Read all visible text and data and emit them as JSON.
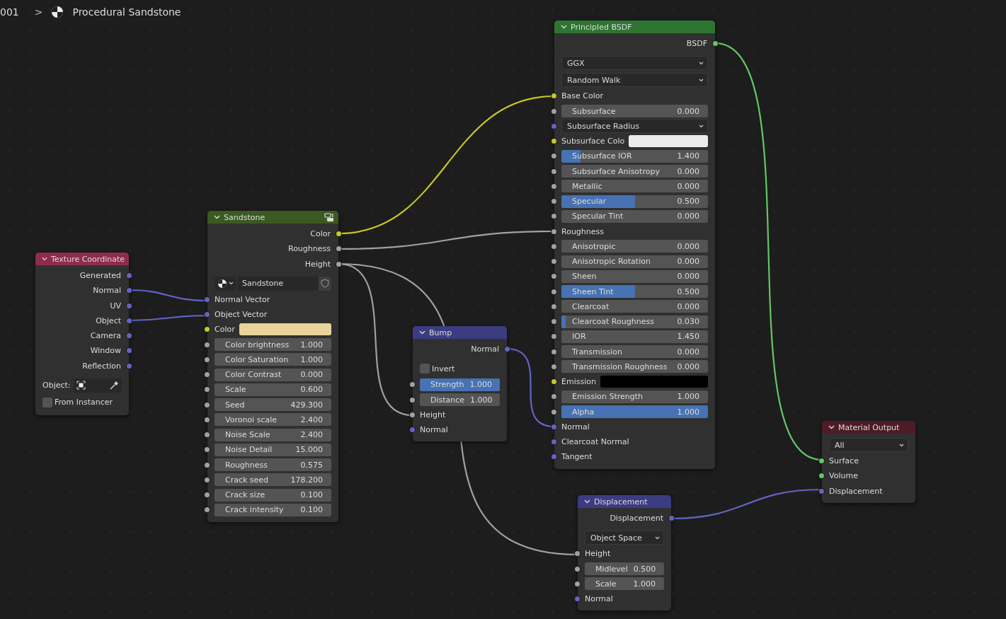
{
  "breadcrumb": {
    "prefix": "001",
    "separator": ">",
    "title": "Procedural Sandstone"
  },
  "nodes": [
    {
      "title": "Texture Coordinate",
      "kind": "shader",
      "color": "#8e2c4c",
      "rows": [
        {
          "kind": "output",
          "label": "Generated",
          "socket": {
            "color": "#6363c7"
          }
        },
        {
          "kind": "output",
          "label": "Normal",
          "socket": {
            "color": "#6363c7"
          }
        },
        {
          "kind": "output",
          "label": "UV",
          "socket": {
            "color": "#6363c7"
          }
        },
        {
          "kind": "output",
          "label": "Object",
          "socket": {
            "color": "#6363c7"
          }
        },
        {
          "kind": "output",
          "label": "Camera",
          "socket": {
            "color": "#6363c7"
          }
        },
        {
          "kind": "output",
          "label": "Window",
          "socket": {
            "color": "#6363c7"
          }
        },
        {
          "kind": "output",
          "label": "Reflection",
          "socket": {
            "color": "#6363c7"
          }
        },
        {
          "kind": "object",
          "label": "Object:"
        },
        {
          "kind": "checkbox",
          "label": "From Instancer",
          "checked": false
        }
      ]
    },
    {
      "title": "Sandstone",
      "kind": "group",
      "color": "#3b5a22",
      "rows": [
        {
          "kind": "output",
          "label": "Color",
          "socket": {
            "color": "#c7c729"
          }
        },
        {
          "kind": "output",
          "label": "Roughness",
          "socket": {
            "color": "#a1a1a1"
          }
        },
        {
          "kind": "output",
          "label": "Height",
          "socket": {
            "color": "#a1a1a1"
          }
        },
        {
          "kind": "datablock",
          "value": "Sandstone"
        },
        {
          "kind": "input",
          "label": "Normal Vector",
          "socket": {
            "color": "#6363c7"
          }
        },
        {
          "kind": "input",
          "label": "Object Vector",
          "socket": {
            "color": "#6363c7"
          }
        },
        {
          "kind": "color",
          "label": "Color",
          "socket": {
            "color": "#c7c729"
          },
          "swatch": {
            "color": "#e8d49a"
          }
        },
        {
          "kind": "slider",
          "label": "Color brightness",
          "value": "1.000",
          "level": 0,
          "socket": {
            "color": "#a1a1a1"
          }
        },
        {
          "kind": "slider",
          "label": "Color Saturation",
          "value": "1.000",
          "level": 0,
          "socket": {
            "color": "#a1a1a1"
          }
        },
        {
          "kind": "slider",
          "label": "Color Contrast",
          "value": "0.000",
          "level": 0,
          "socket": {
            "color": "#a1a1a1"
          }
        },
        {
          "kind": "slider",
          "label": "Scale",
          "value": "0.600",
          "level": 0,
          "socket": {
            "color": "#a1a1a1"
          }
        },
        {
          "kind": "slider",
          "label": "Seed",
          "value": "429.300",
          "level": 0,
          "socket": {
            "color": "#a1a1a1"
          }
        },
        {
          "kind": "slider",
          "label": "Voronoi scale",
          "value": "2.400",
          "level": 0,
          "socket": {
            "color": "#a1a1a1"
          }
        },
        {
          "kind": "slider",
          "label": "Noise Scale",
          "value": "2.400",
          "level": 0,
          "socket": {
            "color": "#a1a1a1"
          }
        },
        {
          "kind": "slider",
          "label": "Noise Detail",
          "value": "15.000",
          "level": 0,
          "socket": {
            "color": "#a1a1a1"
          }
        },
        {
          "kind": "slider",
          "label": "Roughness",
          "value": "0.575",
          "level": 0,
          "socket": {
            "color": "#a1a1a1"
          }
        },
        {
          "kind": "slider",
          "label": "Crack seed",
          "value": "178.200",
          "level": 0,
          "socket": {
            "color": "#a1a1a1"
          }
        },
        {
          "kind": "slider",
          "label": "Crack size",
          "value": "0.100",
          "level": 0,
          "socket": {
            "color": "#a1a1a1"
          }
        },
        {
          "kind": "slider",
          "label": "Crack intensity",
          "value": "0.100",
          "level": 0,
          "socket": {
            "color": "#a1a1a1"
          }
        }
      ]
    },
    {
      "title": "Bump",
      "kind": "shader",
      "color": "#3c3c83",
      "rows": [
        {
          "kind": "output",
          "label": "Normal",
          "socket": {
            "color": "#6363c7"
          }
        },
        {
          "kind": "checkbox",
          "label": "Invert",
          "checked": false
        },
        {
          "kind": "slider",
          "label": "Strength",
          "value": "1.000",
          "level": 1,
          "socket": {
            "color": "#a1a1a1"
          }
        },
        {
          "kind": "slider",
          "label": "Distance",
          "value": "1.000",
          "level": 0,
          "socket": {
            "color": "#a1a1a1"
          }
        },
        {
          "kind": "input",
          "label": "Height",
          "socket": {
            "color": "#a1a1a1"
          }
        },
        {
          "kind": "input",
          "label": "Normal",
          "socket": {
            "color": "#6363c7"
          }
        }
      ]
    },
    {
      "title": "Principled BSDF",
      "kind": "shader",
      "color": "#2e7532",
      "rows": [
        {
          "kind": "output",
          "label": "BSDF",
          "socket": {
            "color": "#63c763"
          }
        },
        {
          "kind": "dropdown",
          "value": "GGX"
        },
        {
          "kind": "dropdown",
          "value": "Random Walk"
        },
        {
          "kind": "input",
          "label": "Base Color",
          "socket": {
            "color": "#c7c729"
          }
        },
        {
          "kind": "slider",
          "label": "Subsurface",
          "value": "0.000",
          "level": 0,
          "socket": {
            "color": "#a1a1a1"
          }
        },
        {
          "kind": "dropdown",
          "value": "Subsurface Radius",
          "socket": {
            "color": "#6363c7"
          }
        },
        {
          "kind": "color",
          "label": "Subsurface Colo",
          "socket": {
            "color": "#c7c729"
          },
          "swatch": {
            "color": "#ececec"
          }
        },
        {
          "kind": "slider",
          "label": "Subsurface IOR",
          "value": "1.400",
          "level": 0.13,
          "socket": {
            "color": "#a1a1a1"
          }
        },
        {
          "kind": "slider",
          "label": "Subsurface Anisotropy",
          "value": "0.000",
          "level": 0,
          "socket": {
            "color": "#a1a1a1"
          }
        },
        {
          "kind": "slider",
          "label": "Metallic",
          "value": "0.000",
          "level": 0,
          "socket": {
            "color": "#a1a1a1"
          }
        },
        {
          "kind": "slider",
          "label": "Specular",
          "value": "0.500",
          "level": 0.5,
          "socket": {
            "color": "#a1a1a1"
          }
        },
        {
          "kind": "slider",
          "label": "Specular Tint",
          "value": "0.000",
          "level": 0,
          "socket": {
            "color": "#a1a1a1"
          }
        },
        {
          "kind": "input",
          "label": "Roughness",
          "socket": {
            "color": "#a1a1a1"
          }
        },
        {
          "kind": "slider",
          "label": "Anisotropic",
          "value": "0.000",
          "level": 0,
          "socket": {
            "color": "#a1a1a1"
          }
        },
        {
          "kind": "slider",
          "label": "Anisotropic Rotation",
          "value": "0.000",
          "level": 0,
          "socket": {
            "color": "#a1a1a1"
          }
        },
        {
          "kind": "slider",
          "label": "Sheen",
          "value": "0.000",
          "level": 0,
          "socket": {
            "color": "#a1a1a1"
          }
        },
        {
          "kind": "slider",
          "label": "Sheen Tint",
          "value": "0.500",
          "level": 0.5,
          "socket": {
            "color": "#a1a1a1"
          }
        },
        {
          "kind": "slider",
          "label": "Clearcoat",
          "value": "0.000",
          "level": 0,
          "socket": {
            "color": "#a1a1a1"
          }
        },
        {
          "kind": "slider",
          "label": "Clearcoat Roughness",
          "value": "0.030",
          "level": 0.03,
          "socket": {
            "color": "#a1a1a1"
          }
        },
        {
          "kind": "slider",
          "label": "IOR",
          "value": "1.450",
          "level": 0,
          "socket": {
            "color": "#a1a1a1"
          }
        },
        {
          "kind": "slider",
          "label": "Transmission",
          "value": "0.000",
          "level": 0,
          "socket": {
            "color": "#a1a1a1"
          }
        },
        {
          "kind": "slider",
          "label": "Transmission Roughness",
          "value": "0.000",
          "level": 0,
          "socket": {
            "color": "#a1a1a1"
          }
        },
        {
          "kind": "color",
          "label": "Emission",
          "socket": {
            "color": "#c7c729"
          },
          "swatch": {
            "color": "#000000"
          }
        },
        {
          "kind": "slider",
          "label": "Emission Strength",
          "value": "1.000",
          "level": 0,
          "socket": {
            "color": "#a1a1a1"
          }
        },
        {
          "kind": "slider",
          "label": "Alpha",
          "value": "1.000",
          "level": 1,
          "socket": {
            "color": "#a1a1a1"
          }
        },
        {
          "kind": "input",
          "label": "Normal",
          "socket": {
            "color": "#6363c7"
          }
        },
        {
          "kind": "input",
          "label": "Clearcoat Normal",
          "socket": {
            "color": "#6363c7"
          }
        },
        {
          "kind": "input",
          "label": "Tangent",
          "socket": {
            "color": "#6363c7"
          }
        }
      ]
    },
    {
      "title": "Material Output",
      "kind": "shader",
      "color": "#4e1c27",
      "rows": [
        {
          "kind": "dropdown",
          "value": "All"
        },
        {
          "kind": "input",
          "label": "Surface",
          "socket": {
            "color": "#63c763"
          }
        },
        {
          "kind": "input",
          "label": "Volume",
          "socket": {
            "color": "#63c763"
          }
        },
        {
          "kind": "input",
          "label": "Displacement",
          "socket": {
            "color": "#6363c7"
          }
        }
      ]
    },
    {
      "title": "Displacement",
      "kind": "shader",
      "color": "#3c3c83",
      "rows": [
        {
          "kind": "output",
          "label": "Displacement",
          "socket": {
            "color": "#6363c7"
          }
        },
        {
          "kind": "dropdown",
          "value": "Object Space"
        },
        {
          "kind": "input",
          "label": "Height",
          "socket": {
            "color": "#a1a1a1"
          }
        },
        {
          "kind": "slider",
          "label": "Midlevel",
          "value": "0.500",
          "level": 0,
          "socket": {
            "color": "#a1a1a1"
          }
        },
        {
          "kind": "slider",
          "label": "Scale",
          "value": "1.000",
          "level": 0,
          "socket": {
            "color": "#a1a1a1"
          }
        },
        {
          "kind": "input",
          "label": "Normal",
          "socket": {
            "color": "#6363c7"
          }
        }
      ]
    }
  ]
}
